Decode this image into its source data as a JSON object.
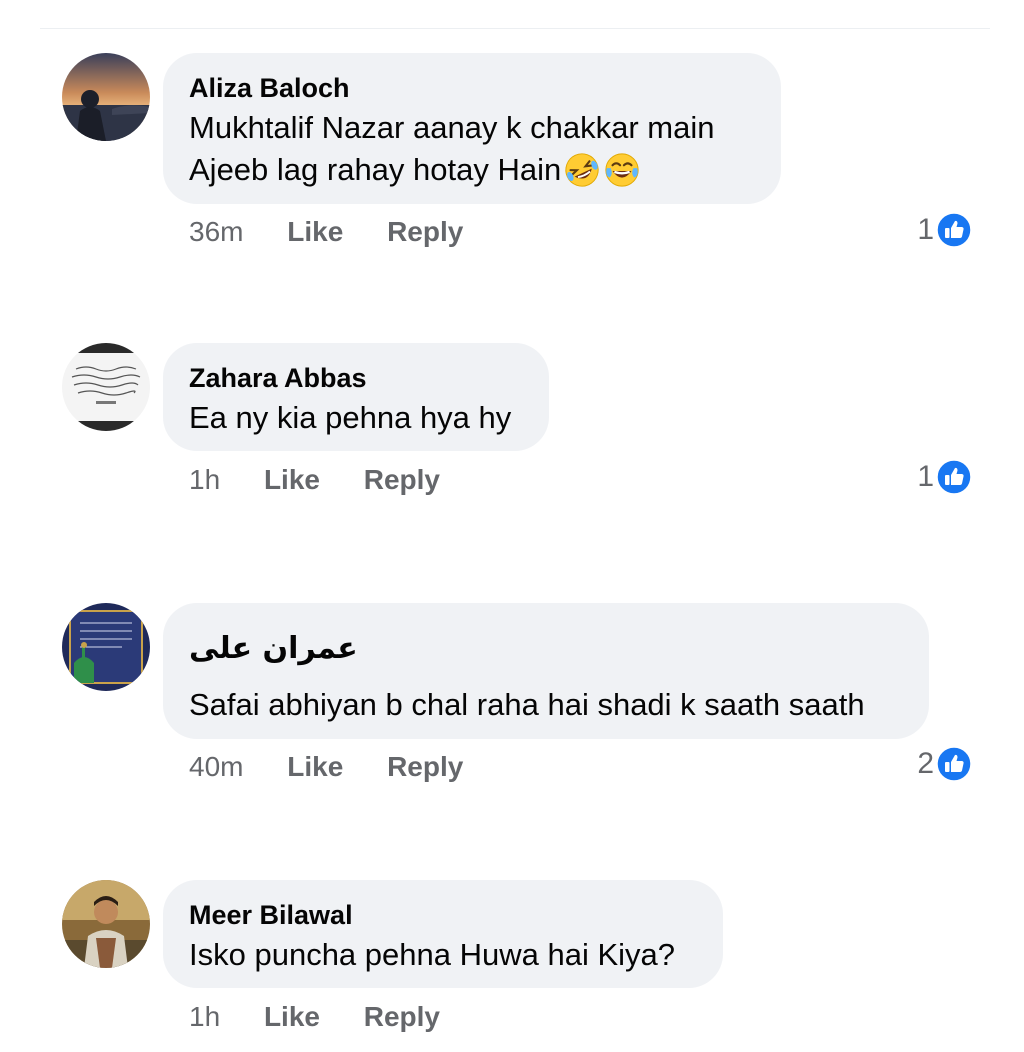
{
  "comments": [
    {
      "author": "Aliza Baloch",
      "lines": [
        "Mukhtalif Nazar aanay  k chakkar main",
        "Ajeeb lag rahay hotay Hain"
      ],
      "emojis": [
        "rolling-on-floor-laughing-emoji",
        "face-with-tears-of-joy-emoji"
      ],
      "time": "36m",
      "like_label": "Like",
      "reply_label": "Reply",
      "reaction_count": "1"
    },
    {
      "author": "Zahara Abbas",
      "lines": [
        "Ea ny kia pehna hya hy"
      ],
      "time": "1h",
      "like_label": "Like",
      "reply_label": "Reply",
      "reaction_count": "1"
    },
    {
      "author": "عمران علی",
      "lines": [
        "Safai abhiyan b chal raha hai shadi k saath saath"
      ],
      "time": "40m",
      "like_label": "Like",
      "reply_label": "Reply",
      "reaction_count": "2"
    },
    {
      "author": "Meer Bilawal",
      "lines": [
        "Isko puncha pehna Huwa hai Kiya?"
      ],
      "time": "1h",
      "like_label": "Like",
      "reply_label": "Reply"
    }
  ],
  "colors": {
    "bubble": "#f0f2f5",
    "secondary_text": "#65676b",
    "like_blue": "#1877f2"
  }
}
